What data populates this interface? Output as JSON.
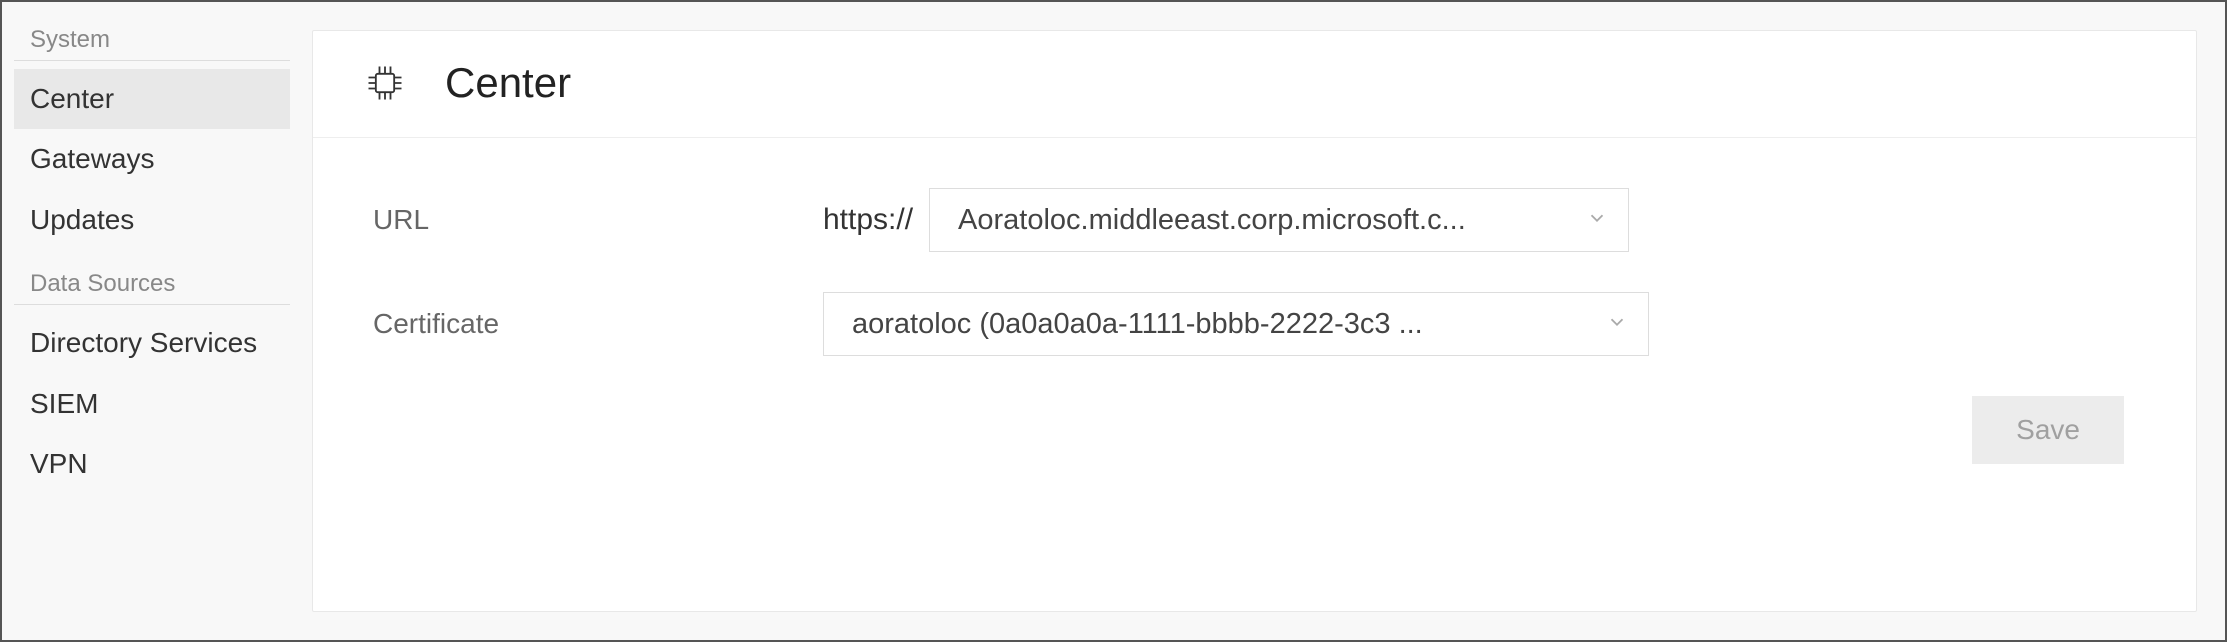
{
  "sidebar": {
    "sections": [
      {
        "header": "System",
        "items": [
          {
            "label": "Center",
            "active": true
          },
          {
            "label": "Gateways",
            "active": false
          },
          {
            "label": "Updates",
            "active": false
          }
        ]
      },
      {
        "header": "Data Sources",
        "items": [
          {
            "label": "Directory Services",
            "active": false
          },
          {
            "label": "SIEM",
            "active": false
          },
          {
            "label": "VPN",
            "active": false
          }
        ]
      }
    ]
  },
  "main": {
    "title": "Center",
    "icon": "chip-icon",
    "form": {
      "url": {
        "label": "URL",
        "prefix": "https://",
        "value": "Aoratoloc.middleeast.corp.microsoft.c..."
      },
      "certificate": {
        "label": "Certificate",
        "value": "aoratoloc (0a0a0a0a-1111-bbbb-2222-3c3 ..."
      }
    },
    "save_label": "Save"
  }
}
